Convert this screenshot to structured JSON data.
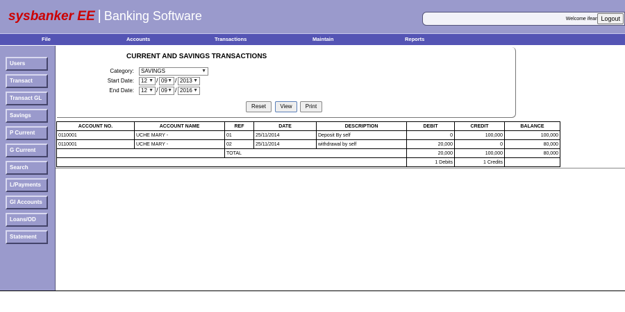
{
  "header": {
    "brand_name": "sysbanker EE",
    "brand_sep": "|",
    "brand_sub": "Banking Software",
    "welcome": "Welcome ifeanyi",
    "logout_label": "Logout"
  },
  "menu": [
    "File",
    "Accounts",
    "Transactions",
    "Maintain",
    "Reports"
  ],
  "sidebar": [
    "Users",
    "Transact",
    "Transact GL",
    "Savings",
    "P Current",
    "G Current",
    "Search",
    "L/Payments",
    "Gl Accounts",
    "Loans/OD",
    "Statement"
  ],
  "form": {
    "title": "CURRENT AND SAVINGS TRANSACTIONS",
    "category_label": "Category:",
    "category_value": "SAVINGS",
    "start_label": "Start Date:",
    "start_day": "12",
    "start_month": "09",
    "start_year": "2013",
    "end_label": "End Date:",
    "end_day": "12",
    "end_month": "09",
    "end_year": "2016",
    "date_sep": "/",
    "reset_label": "Reset",
    "view_label": "View",
    "print_label": "Print"
  },
  "table": {
    "columns": [
      "ACCOUNT NO.",
      "ACCOUNT NAME",
      "REF",
      "DATE",
      "DESCRIPTION",
      "DEBIT",
      "CREDIT",
      "BALANCE"
    ],
    "rows": [
      [
        "0110001",
        "UCHE MARY -",
        "01",
        "25/11/2014",
        "Deposit By self",
        "0",
        "100,000",
        "100,000"
      ],
      [
        "0110001",
        "UCHE MARY -",
        "02",
        "25/11/2014",
        "withdrawal by self",
        "20,000",
        "0",
        "80,000"
      ]
    ],
    "total_label": "TOTAL",
    "total_debit": "20,000",
    "total_credit": "100,000",
    "total_balance": "80,000",
    "debits_count": "1 Debits",
    "credits_count": "1 Credits"
  },
  "colors": {
    "header_bg": "#9a9acc",
    "menubar_bg": "#5454b4",
    "brand_red": "#cc0000"
  }
}
